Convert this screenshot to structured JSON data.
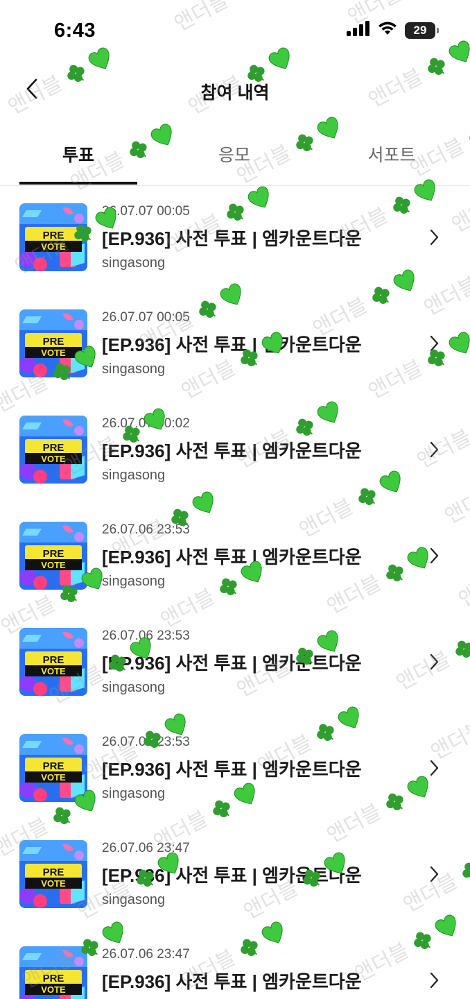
{
  "status_bar": {
    "time": "6:43",
    "battery": "29",
    "icons": [
      "signal-icon",
      "wifi-icon",
      "battery-icon"
    ]
  },
  "header": {
    "back_icon": "chevron-left-icon",
    "title": "참여 내역"
  },
  "tabs": [
    {
      "label": "투표",
      "active": true
    },
    {
      "label": "응모",
      "active": false
    },
    {
      "label": "서포트",
      "active": false
    }
  ],
  "thumbnail": {
    "line1": "PRE",
    "line2": "VOTE"
  },
  "items": [
    {
      "date": "26.07.07 00:05",
      "title": "[EP.936] 사전 투표 | 엠카운트다운",
      "channel": "singasong"
    },
    {
      "date": "26.07.07 00:05",
      "title": "[EP.936] 사전 투표 | 엠카운트다운",
      "channel": "singasong"
    },
    {
      "date": "26.07.07 00:02",
      "title": "[EP.936] 사전 투표 | 엠카운트다운",
      "channel": "singasong"
    },
    {
      "date": "26.07.06 23:53",
      "title": "[EP.936] 사전 투표 | 엠카운트다운",
      "channel": "singasong"
    },
    {
      "date": "26.07.06 23:53",
      "title": "[EP.936] 사전 투표 | 엠카운트다운",
      "channel": "singasong"
    },
    {
      "date": "26.07.06 23:53",
      "title": "[EP.936] 사전 투표 | 엠카운트다운",
      "channel": "singasong"
    },
    {
      "date": "26.07.06 23:47",
      "title": "[EP.936] 사전 투표 | 엠카운트다운",
      "channel": "singasong"
    },
    {
      "date": "26.07.06 23:47",
      "title": "[EP.936] 사전 투표 | 엠카운트다운",
      "channel": ""
    }
  ],
  "watermark": {
    "text": "앤더블",
    "icons": [
      "clover-icon",
      "green-heart-icon"
    ]
  },
  "colors": {
    "text_primary": "#111111",
    "text_secondary": "#555555",
    "clover": "#2f9e2f",
    "heart": "#3ec93e",
    "thumb_bg": "#2a6ef0",
    "thumb_banner": "#f5e634"
  }
}
